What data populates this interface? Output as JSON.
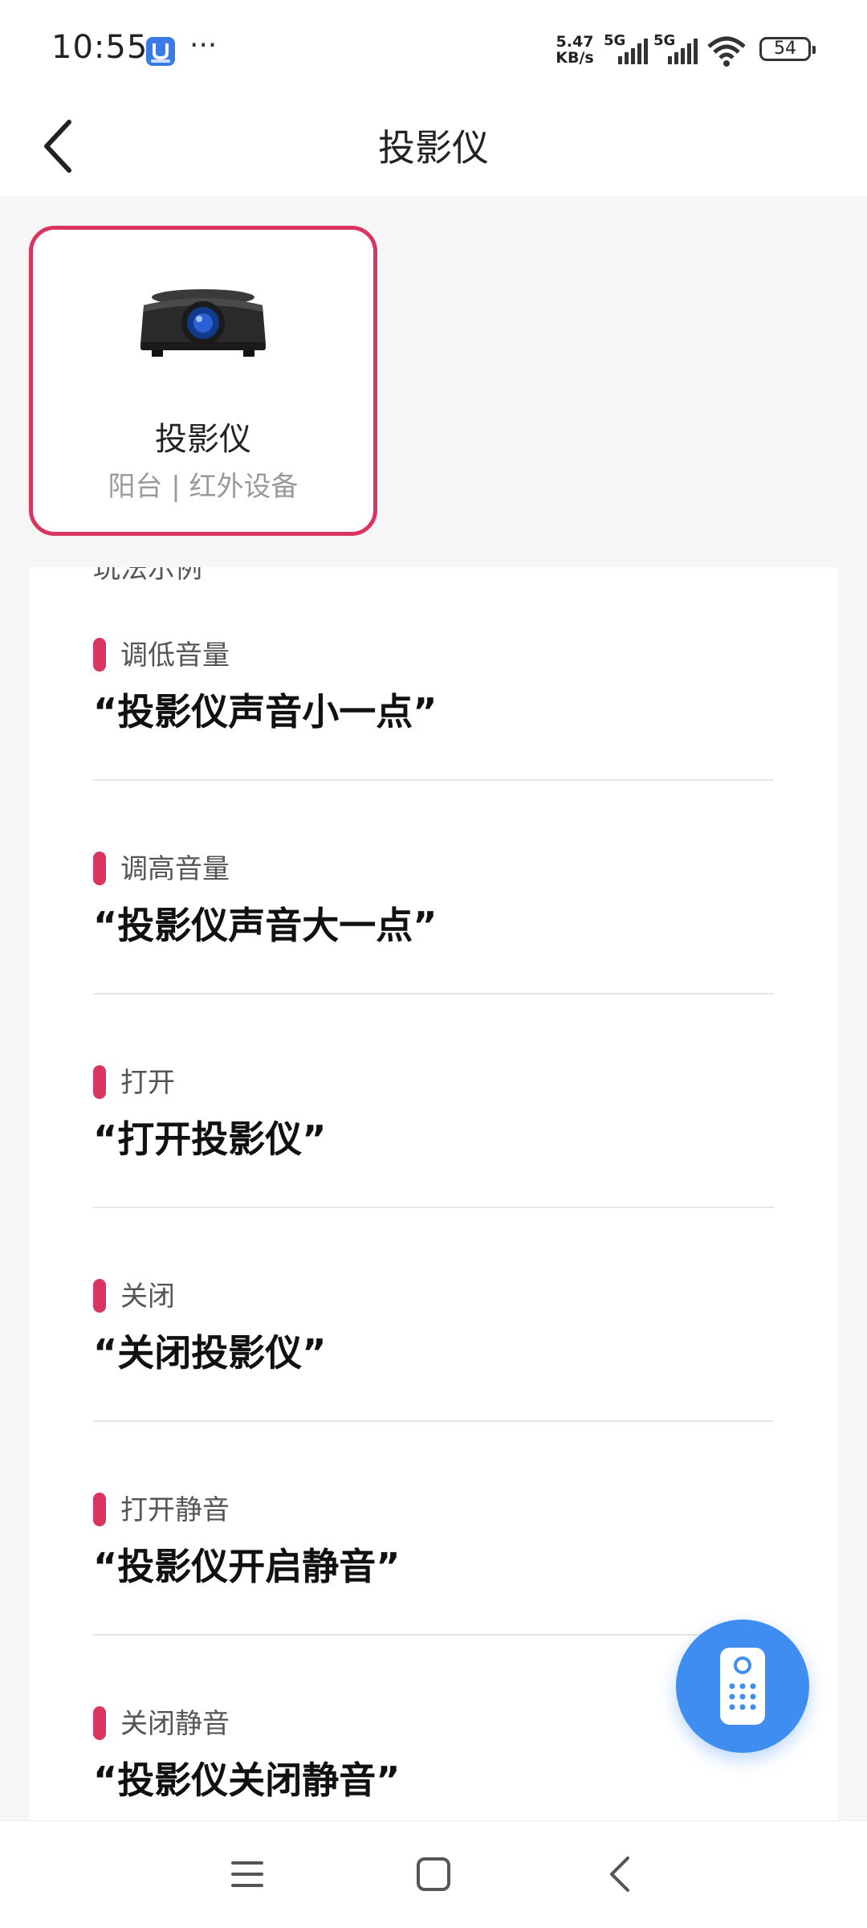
{
  "status_bar": {
    "time": "10:55",
    "app_icon": "app-badge-icon",
    "more": "···",
    "net_speed_value": "5.47",
    "net_speed_unit": "KB/s",
    "sim1_tag": "5G",
    "sim2_tag": "5G",
    "battery": "54"
  },
  "header": {
    "back_icon": "chevron-left-icon",
    "title": "投影仪"
  },
  "device_card": {
    "icon": "projector-icon",
    "name": "投影仪",
    "subtitle": "阳台 | 红外设备"
  },
  "commands_section": {
    "heading": "玩法示例",
    "items": [
      {
        "label": "调低音量",
        "phrase": "“投影仪声音小一点”"
      },
      {
        "label": "调高音量",
        "phrase": "“投影仪声音大一点”"
      },
      {
        "label": "打开",
        "phrase": "“打开投影仪”"
      },
      {
        "label": "关闭",
        "phrase": "“关闭投影仪”"
      },
      {
        "label": "打开静音",
        "phrase": "“投影仪开启静音”"
      },
      {
        "label": "关闭静音",
        "phrase": "“投影仪关闭静音”"
      }
    ]
  },
  "fab": {
    "icon": "remote-control-icon"
  },
  "nav_bar": {
    "menu_icon": "menu-icon",
    "home_icon": "home-square-icon",
    "back_icon": "back-triangle-icon"
  },
  "colors": {
    "accent": "#d9355e",
    "fab": "#3f8df0",
    "background": "#f6f6f6"
  }
}
